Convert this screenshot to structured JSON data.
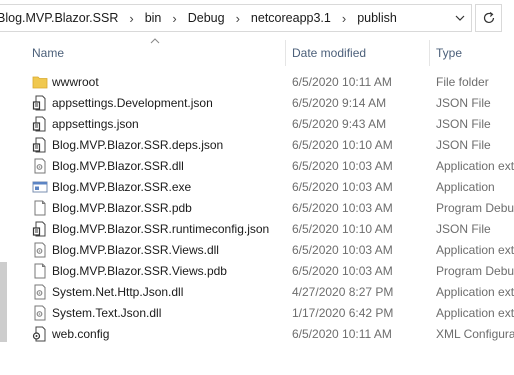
{
  "address_bar": {
    "crumbs": [
      "Blog.MVP.Blazor.SSR",
      "bin",
      "Debug",
      "netcoreapp3.1",
      "publish"
    ]
  },
  "columns": {
    "name": "Name",
    "date_modified": "Date modified",
    "type": "Type"
  },
  "files": [
    {
      "name": "wwwroot",
      "date": "6/5/2020 10:11 AM",
      "type": "File folder",
      "icon": "folder-icon"
    },
    {
      "name": "appsettings.Development.json",
      "date": "6/5/2020 9:14 AM",
      "type": "JSON File",
      "icon": "json-file-icon"
    },
    {
      "name": "appsettings.json",
      "date": "6/5/2020 9:43 AM",
      "type": "JSON File",
      "icon": "json-file-icon"
    },
    {
      "name": "Blog.MVP.Blazor.SSR.deps.json",
      "date": "6/5/2020 10:10 AM",
      "type": "JSON File",
      "icon": "json-file-icon"
    },
    {
      "name": "Blog.MVP.Blazor.SSR.dll",
      "date": "6/5/2020 10:03 AM",
      "type": "Application ext",
      "icon": "dll-file-icon"
    },
    {
      "name": "Blog.MVP.Blazor.SSR.exe",
      "date": "6/5/2020 10:03 AM",
      "type": "Application",
      "icon": "exe-file-icon"
    },
    {
      "name": "Blog.MVP.Blazor.SSR.pdb",
      "date": "6/5/2020 10:03 AM",
      "type": "Program Debu",
      "icon": "pdb-file-icon"
    },
    {
      "name": "Blog.MVP.Blazor.SSR.runtimeconfig.json",
      "date": "6/5/2020 10:10 AM",
      "type": "JSON File",
      "icon": "json-file-icon"
    },
    {
      "name": "Blog.MVP.Blazor.SSR.Views.dll",
      "date": "6/5/2020 10:03 AM",
      "type": "Application ext",
      "icon": "dll-file-icon"
    },
    {
      "name": "Blog.MVP.Blazor.SSR.Views.pdb",
      "date": "6/5/2020 10:03 AM",
      "type": "Program Debu",
      "icon": "pdb-file-icon"
    },
    {
      "name": "System.Net.Http.Json.dll",
      "date": "4/27/2020 8:27 PM",
      "type": "Application ext",
      "icon": "dll-file-icon"
    },
    {
      "name": "System.Text.Json.dll",
      "date": "1/17/2020 6:42 PM",
      "type": "Application ext",
      "icon": "dll-file-icon"
    },
    {
      "name": "web.config",
      "date": "6/5/2020 10:11 AM",
      "type": "XML Configura",
      "icon": "config-file-icon"
    }
  ],
  "colors": {
    "folder": "#f0c84f",
    "header_text": "#4c607a",
    "meta_text": "#6d6d6d"
  }
}
